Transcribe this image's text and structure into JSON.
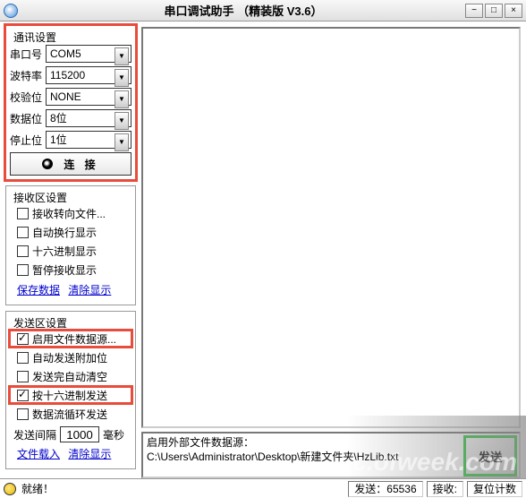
{
  "title": "串口调试助手 （精装版 V3.6）",
  "comm": {
    "legend": "通讯设置",
    "port_label": "串口号",
    "port_value": "COM5",
    "baud_label": "波特率",
    "baud_value": "115200",
    "parity_label": "校验位",
    "parity_value": "NONE",
    "data_label": "数据位",
    "data_value": "8位",
    "stop_label": "停止位",
    "stop_value": "1位",
    "connect": "连 接"
  },
  "recv": {
    "legend": "接收区设置",
    "to_file": "接收转向文件...",
    "auto_wrap": "自动换行显示",
    "hex": "十六进制显示",
    "pause": "暂停接收显示",
    "save": "保存数据",
    "clear": "清除显示"
  },
  "send": {
    "legend": "发送区设置",
    "file_src": "启用文件数据源...",
    "auto_extra": "自动发送附加位",
    "clear_done": "发送完自动清空",
    "hex": "按十六进制发送",
    "loop": "数据流循环发送",
    "interval_label": "发送间隔",
    "interval_value": "1000",
    "interval_unit": "毫秒",
    "load_file": "文件载入",
    "clear": "清除显示"
  },
  "datasource": {
    "label": "启用外部文件数据源：",
    "path": "C:\\Users\\Administrator\\Desktop\\新建文件夹\\HzLib.txt",
    "send_btn": "发送"
  },
  "status": {
    "ready": "就绪！",
    "send_count_label": "发送：",
    "send_count": "65536",
    "recv_count_label": "接收:",
    "recv_count": "",
    "reset": "复位计数"
  },
  "watermark": "pc.ofweek.com"
}
